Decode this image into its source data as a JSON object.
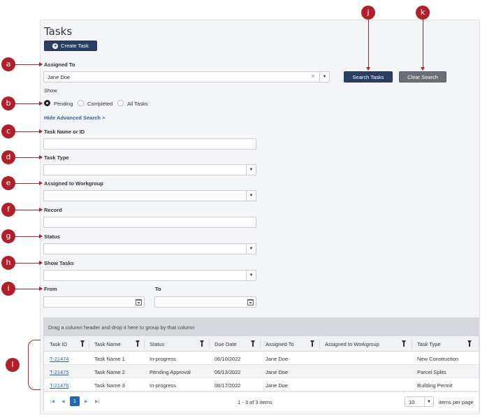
{
  "page": {
    "title": "Tasks",
    "create_task_label": "Create Task",
    "search_tasks_label": "Search Tasks",
    "clear_search_label": "Clear Search"
  },
  "form": {
    "assigned_to_label": "Assigned To",
    "assigned_to_value": "Jane Doe",
    "show_label": "Show",
    "show_options": [
      "Pending",
      "Completed",
      "All Tasks"
    ],
    "show_selected": "Pending",
    "advanced_link": "Hide Advanced Search >",
    "task_name_label": "Task Name or ID",
    "task_type_label": "Task Type",
    "workgroup_label": "Assigned to Workgroup",
    "record_label": "Record",
    "status_label": "Status",
    "show_tasks_label": "Show Tasks",
    "from_label": "From",
    "to_label": "To"
  },
  "callouts": [
    "a",
    "b",
    "c",
    "d",
    "e",
    "f",
    "g",
    "h",
    "i",
    "j",
    "k",
    "l"
  ],
  "callout_color": "#b0202a",
  "grid": {
    "group_hint": "Drag a column header and drop it here to group by that column",
    "columns": [
      "Task ID",
      "Task Name",
      "Status",
      "Due Date",
      "Assigned To",
      "Assigned to Workgroup",
      "Task Type"
    ],
    "rows": [
      {
        "id": "T-21474",
        "name": "Task Name 1",
        "status": "In-progress",
        "due": "06/10/2022",
        "assigned": "Jane Doe",
        "workgroup": "",
        "type": "New Construction"
      },
      {
        "id": "T-21475",
        "name": "Task Name 2",
        "status": "Pending Approval",
        "due": "06/13/2022",
        "assigned": "Jane Doe",
        "workgroup": "",
        "type": "Parcel Splits"
      },
      {
        "id": "T-21476",
        "name": "Task Name 3",
        "status": "In-progress",
        "due": "06/17/2022",
        "assigned": "Jane Doe",
        "workgroup": "",
        "type": "Building Permit"
      }
    ],
    "pager": {
      "current_page": "1",
      "count_text": "1 - 3 of 3 items",
      "page_size": "10",
      "items_per_page_label": "items per page"
    }
  },
  "colors": {
    "primary_button": "#2b3d63",
    "secondary_button": "#6b6e74",
    "link": "#2766b3"
  }
}
